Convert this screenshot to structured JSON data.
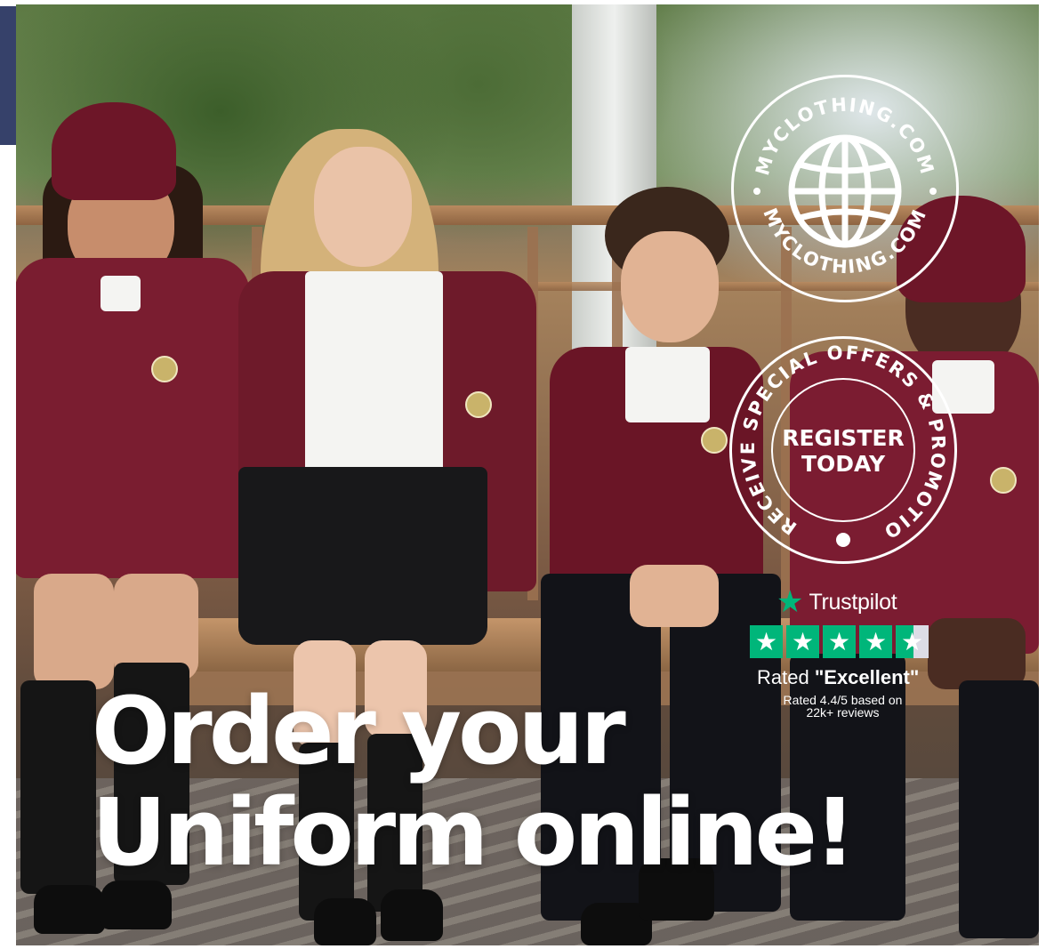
{
  "site_stamp": {
    "top_arc_text": "MYCLOTHING.COM",
    "bottom_arc_text": "MYCLOTHING.COM",
    "icon": "globe-icon"
  },
  "promo_stamp": {
    "arc_text": "TO RECEIVE SPECIAL OFFERS & PROMOTIONS",
    "line1": "REGISTER",
    "line2": "TODAY"
  },
  "trustpilot": {
    "brand": "Trustpilot",
    "stars_filled": 4.5,
    "stars_total": 5,
    "rated_prefix": "Rated",
    "rating_word": "\"Excellent\"",
    "summary_line1": "Rated 4.4/5 based on",
    "summary_line2": "22k+ reviews",
    "color": "#00b67a"
  },
  "headline": {
    "line1": "Order your",
    "line2": "Uniform online!"
  },
  "colors": {
    "uniform_maroon": "#741a2c",
    "nav_strip": "#36416a"
  }
}
